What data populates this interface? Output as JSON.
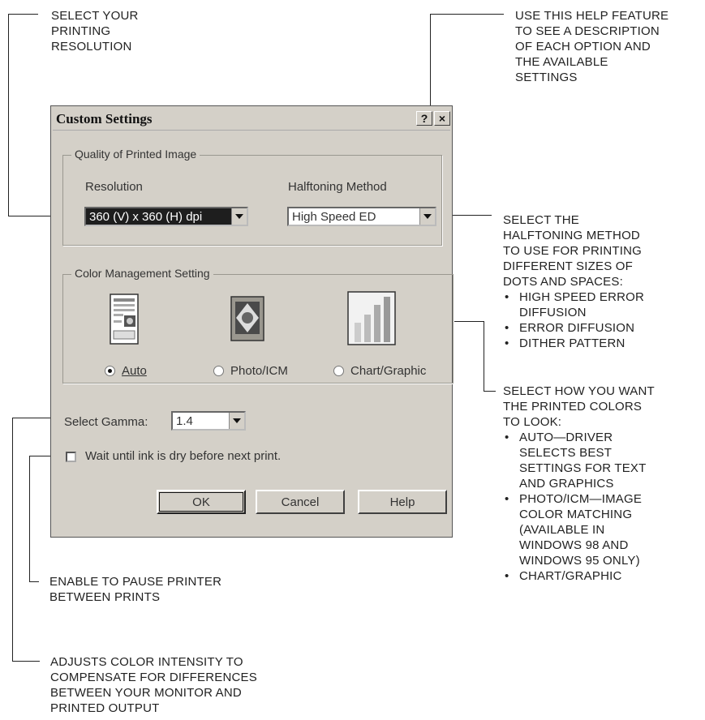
{
  "annotations": {
    "resolution": "SELECT YOUR\nPRINTING\nRESOLUTION",
    "help": "USE THIS HELP FEATURE\nTO SEE A DESCRIPTION\nOF EACH OPTION AND\nTHE AVAILABLE\nSETTINGS",
    "halftoning": "SELECT THE\nHALFTONING METHOD\nTO USE FOR PRINTING\nDIFFERENT SIZES OF\nDOTS AND SPACES:",
    "halftoning_items": [
      "HIGH SPEED ERROR DIFFUSION",
      "ERROR DIFFUSION",
      "DITHER PATTERN"
    ],
    "color": "SELECT HOW YOU WANT\nTHE PRINTED COLORS\nTO LOOK:",
    "color_items": [
      "AUTO—DRIVER SELECTS BEST SETTINGS FOR TEXT AND GRAPHICS",
      "PHOTO/ICM—IMAGE COLOR MATCHING (AVAILABLE IN WINDOWS 98 AND WINDOWS 95 ONLY)",
      "CHART/GRAPHIC"
    ],
    "pause": "ENABLE TO PAUSE PRINTER\nBETWEEN PRINTS",
    "gamma": "ADJUSTS COLOR INTENSITY TO\nCOMPENSATE FOR DIFFERENCES\nBETWEEN YOUR  MONITOR AND\nPRINTED OUTPUT"
  },
  "dialog": {
    "title": "Custom Settings",
    "help_btn": "?",
    "close_btn": "×",
    "quality_group": "Quality of Printed Image",
    "resolution_label": "Resolution",
    "resolution_value": "360 (V) x 360 (H) dpi",
    "halftoning_label": "Halftoning Method",
    "halftoning_value": "High Speed ED",
    "color_group": "Color Management Setting",
    "options": [
      "Auto",
      "Photo/ICM",
      "Chart/Graphic"
    ],
    "selected_option": "Auto",
    "gamma_label": "Select Gamma:",
    "gamma_value": "1.4",
    "wait_label": "Wait until ink is dry before next print.",
    "wait_checked": false,
    "ok": "OK",
    "cancel": "Cancel",
    "help": "Help"
  }
}
